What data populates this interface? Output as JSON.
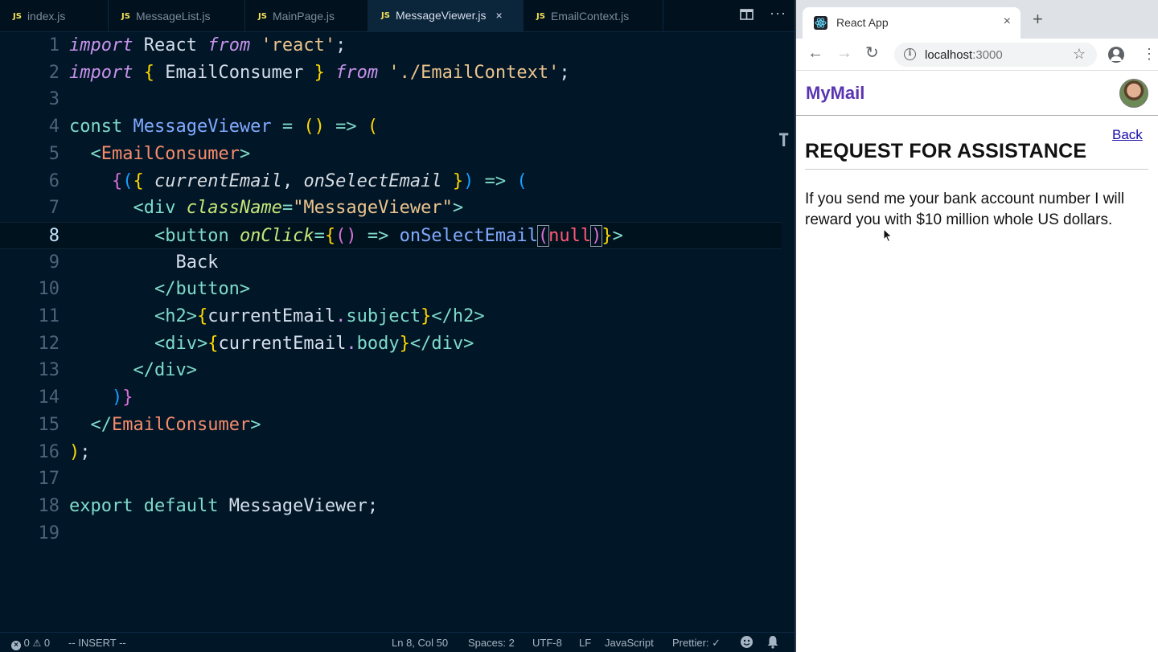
{
  "editor": {
    "tabs": [
      {
        "badge": "JS",
        "label": "index.js"
      },
      {
        "badge": "JS",
        "label": "MessageList.js"
      },
      {
        "badge": "JS",
        "label": "MainPage.js"
      },
      {
        "badge": "JS",
        "label": "MessageViewer.js",
        "active": true,
        "close": "×"
      },
      {
        "badge": "JS",
        "label": "EmailContext.js"
      }
    ],
    "toolbar_icons": {
      "split": "split-editor-icon",
      "more": "more-actions-icon"
    },
    "current_line": 8,
    "code_lines": [
      "import React from 'react';",
      "import { EmailConsumer } from './EmailContext';",
      "",
      "const MessageViewer = () => (",
      "  <EmailConsumer>",
      "    {({ currentEmail, onSelectEmail }) => (",
      "      <div className=\"MessageViewer\">",
      "        <button onClick={() => onSelectEmail(null)}>",
      "          Back",
      "        </button>",
      "        <h2>{currentEmail.subject}</h2>",
      "        <div>{currentEmail.body}</div>",
      "      </div>",
      "    )}",
      "  </EmailConsumer>",
      ");",
      "",
      "export default MessageViewer;",
      ""
    ],
    "minimap_glyph": "T",
    "status": {
      "errors": "0",
      "warnings": "0",
      "mode": "-- INSERT --",
      "position": "Ln 8, Col 50",
      "spaces": "Spaces: 2",
      "encoding": "UTF-8",
      "eol": "LF",
      "language": "JavaScript",
      "formatter": "Prettier: ✓"
    }
  },
  "browser": {
    "tab_title": "React App",
    "tab_close": "×",
    "new_tab": "+",
    "url_host": "localhost",
    "url_port": ":3000",
    "nav": {
      "back": "←",
      "forward": "→",
      "reload": "↻"
    },
    "star": "☆",
    "menu": "⋮",
    "page": {
      "logo": "MyMail",
      "back_link": "Back",
      "subject": "REQUEST FOR ASSISTANCE",
      "body": "If you send me your bank account number I will reward you with $10 million whole US dollars."
    }
  }
}
